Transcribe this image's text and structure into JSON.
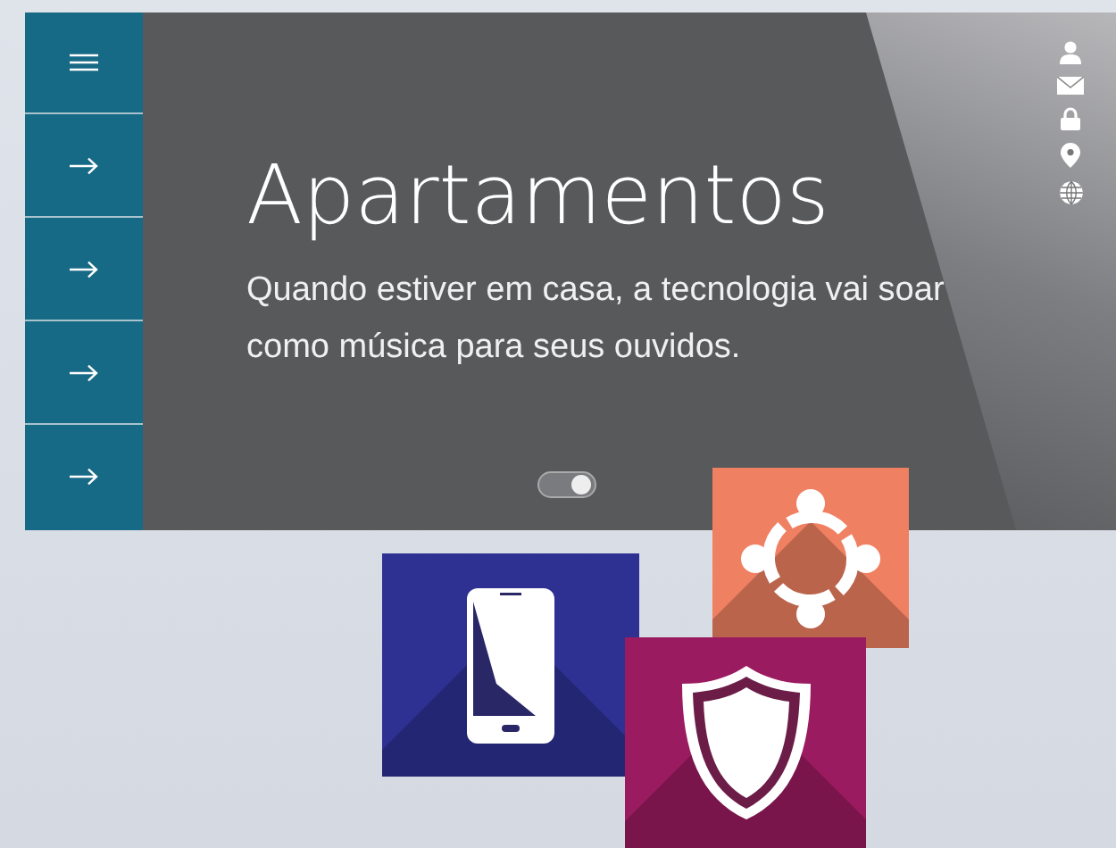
{
  "hero": {
    "title": "Apartamentos",
    "text": "Quando estiver em casa, a tecnologia vai soar como música para seus ouvidos."
  },
  "slider_toggle": {
    "on": true
  },
  "tiles": [
    {
      "kind": "phone",
      "color": "#2e3192"
    },
    {
      "kind": "team",
      "color": "#f08062"
    },
    {
      "kind": "shield",
      "color": "#9b1b60"
    }
  ]
}
